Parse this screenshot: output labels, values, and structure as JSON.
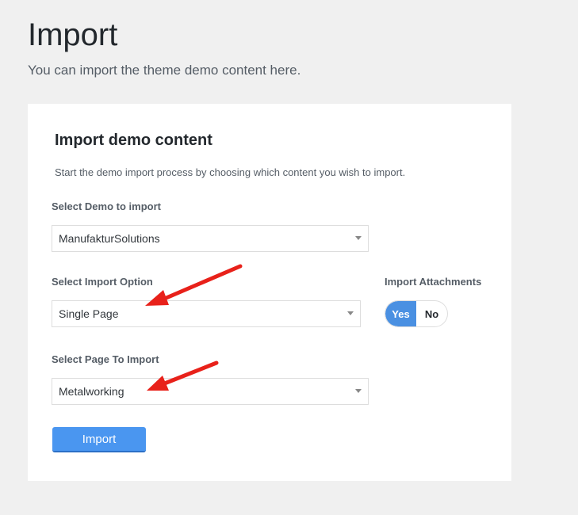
{
  "header": {
    "title": "Import",
    "subtitle": "You can import the theme demo content here."
  },
  "card": {
    "title": "Import demo content",
    "description": "Start the demo import process by choosing which content you wish to import.",
    "demo_select": {
      "label": "Select Demo to import",
      "value": "ManufakturSolutions"
    },
    "option_select": {
      "label": "Select Import Option",
      "value": "Single Page"
    },
    "attachments": {
      "label": "Import Attachments",
      "yes": "Yes",
      "no": "No",
      "selected": "Yes"
    },
    "page_select": {
      "label": "Select Page To Import",
      "value": "Metalworking"
    },
    "import_button": "Import"
  },
  "colors": {
    "accent": "#4a90e2",
    "arrow": "#e8211a",
    "background": "#f0f0f0"
  }
}
